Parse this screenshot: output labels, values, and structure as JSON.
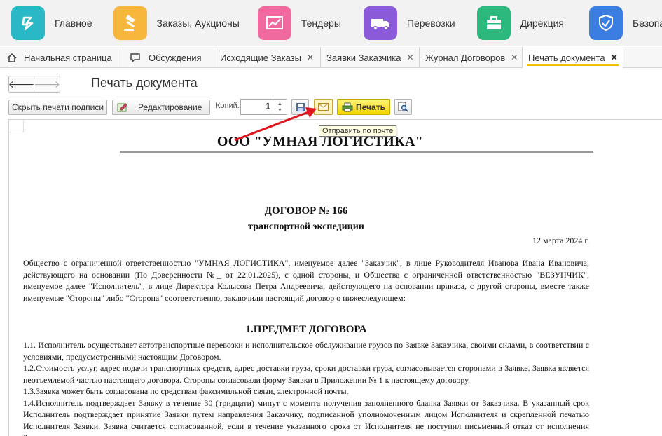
{
  "sections": [
    {
      "label": "Главное",
      "icon": "stripe-logo-icon",
      "color": "#29b8c6"
    },
    {
      "label": "Заказы, Аукционы",
      "icon": "gavel-icon",
      "color": "#f6b73c"
    },
    {
      "label": "Тендеры",
      "icon": "chart-line-icon",
      "color": "#f06aa0"
    },
    {
      "label": "Перевозки",
      "icon": "truck-icon",
      "color": "#8a5ad8"
    },
    {
      "label": "Дирекция",
      "icon": "briefcase-icon",
      "color": "#2db87d"
    },
    {
      "label": "Безопасность",
      "icon": "shield-check-icon",
      "color": "#3b7de0"
    }
  ],
  "tabs": [
    {
      "label": "Начальная страница",
      "icon": "home-icon"
    },
    {
      "label": "Обсуждения",
      "icon": "chat-icon"
    },
    {
      "label": "Исходящие Заказы",
      "close": "✕"
    },
    {
      "label": "Заявки Заказчика",
      "close": "✕"
    },
    {
      "label": "Журнал Договоров",
      "close": "✕"
    },
    {
      "label": "Печать документа",
      "close": "✕",
      "active": true
    }
  ],
  "nav": {
    "back": "🡐",
    "forward": "🡒"
  },
  "page_title": "Печать документа",
  "toolbar": {
    "hide_signatures": "Скрыть печати подписи",
    "edit": "Редактирование",
    "copies_label": "Копий:",
    "copies_value": "1",
    "print": "Печать",
    "tooltip": "Отправить по почте"
  },
  "document": {
    "company": "ООО \"УМНАЯ ЛОГИСТИКА\"",
    "title": "ДОГОВОР № 166",
    "subtitle": "транспортной экспедиции",
    "date": "12 марта 2024 г.",
    "intro": "Общество с ограниченной ответственностью \"УМНАЯ ЛОГИСТИКА\", именуемое далее \"Заказчик\", в лице Руководителя Иванова Ивана Ивановича, действующего на основании (По Доверенности №_ от 22.01.2025), с одной стороны, и Общества с ограниченной ответственностью \"ВЕЗУНЧИК\", именуемое далее \"Исполнитель\", в лице Директора Колысова Петра Андреевича, действующего на основании приказа, с другой стороны, вместе также именуемые \"Стороны\" либо \"Сторона\" соответственно, заключили настоящий договор о нижеследующем:",
    "section1_title": "1.ПРЕДМЕТ ДОГОВОРА",
    "clauses": [
      "1.1. Исполнитель осуществляет автотранспортные перевозки и исполнительское обслуживание грузов по Заявке Заказчика, своими силами, в соответствии с условиями, предусмотренными настоящим Договором.",
      "1.2.Стоимость услуг, адрес подачи транспортных средств, адрес доставки груза, сроки доставки груза, согласовывается сторонами в Заявке. Заявка является неотъемлемой частью настоящего договора. Стороны согласовали форму Заявки в Приложении № 1 к настоящему договору.",
      "1.3.Заявка может быть согласована по средствам факсимильной связи, электронной почты.",
      "1.4.Исполнитель подтверждает Заявку в течение 30 (тридцати) минут с момента получения заполненного бланка Заявки от Заказчика. В указанный срок Исполнитель подтверждает принятие Заявки путем направления Заказчику, подписанной уполномоченным лицом Исполнителя и скрепленной печатью Исполнителя Заявки. Заявка считается согласованной, если в течение указанного срока от Исполнителя не поступил письменный отказ от исполнения Заявки."
    ]
  }
}
